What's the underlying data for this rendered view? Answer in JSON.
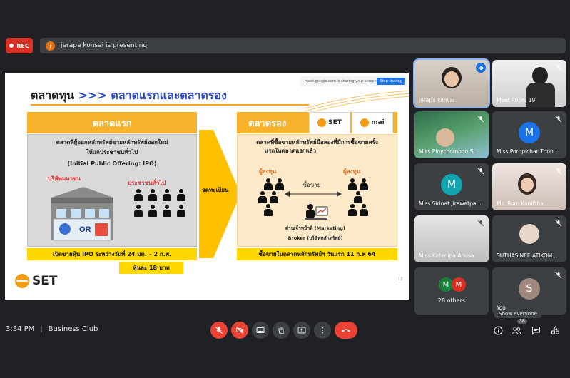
{
  "top": {
    "rec_label": "REC",
    "presenter_initial": "j",
    "presenting_text": "jerapa konsai is presenting"
  },
  "slide": {
    "share_banner": "meet.google.com is sharing your screen.",
    "stop_sharing": "Stop sharing",
    "title_prefix": "ตลาดทุน ",
    "title_arrow": ">>>",
    "title_rest": " ตลาดแรกและตลาดรอง",
    "left_header": "ตลาดแรก",
    "left_desc_1": "ตลาดที่ผู้ออกหลักทรัพย์ขายหลักทรัพย์ออกใหม่",
    "left_desc_2": "ให้แก่ประชาชนทั่วไป",
    "left_desc_3": "(Initial Public Offering: IPO)",
    "company_label": "บริษัทมหาชน",
    "public_label": "ประชาชนทั่วไป",
    "left_strip": "เปิดขายหุ้น IPO ระหว่างวันที่ 24 มค. – 2 ก.พ.",
    "price_strip": "หุ้นละ 18 บาท",
    "arrow_label": "จดทะเบียน",
    "right_header": "ตลาดรอง",
    "set_logo_text": "SET",
    "set_logo_sub": "The Stock Exchange of Thailand",
    "mai_logo_text": "mai",
    "mai_logo_sub": "Market for Alternative Investment",
    "right_desc_1": "ตลาดที่ซื้อขายหลักทรัพย์มือสองที่มีการซื้อขายครั้ง",
    "right_desc_2": "แรกในตลาดแรกแล้ว",
    "investor_left": "ผู้ลงทุน",
    "investor_right": "ผู้ลงทุน",
    "trade_label": "ซื้อขาย",
    "marketing_label": "ผ่านเจ้าหน้าที่ (Marketing)",
    "broker_label": "Broker (บริษัทหลักทรัพย์)",
    "right_strip": "ซื้อขายในตลาดหลักทรัพย์ฯ วันแรก 11 ก.พ 64",
    "footer_logo": "SET",
    "page_number": "12"
  },
  "tiles": [
    {
      "name": "jerapa konsai",
      "type": "video",
      "bg": "#cfc7bd",
      "speaking": true
    },
    {
      "name": "Meet Room 19",
      "type": "video",
      "bg": "#e8e8e8",
      "speaking": false
    },
    {
      "name": "Miss Ploychompoo S...",
      "type": "video",
      "bg": "#3b7a55",
      "speaking": false
    },
    {
      "name": "Miss Pornpichar Thon...",
      "type": "avatar",
      "initial": "M",
      "color": "#1a73e8"
    },
    {
      "name": "Miss Sirinat Jirawatpa...",
      "type": "avatar",
      "initial": "M",
      "color": "#12a4af"
    },
    {
      "name": "Ms. Rom Kanittha...",
      "type": "video",
      "bg": "#e1d6d3",
      "speaking": false
    },
    {
      "name": "Miss Katenipa Anusa...",
      "type": "video",
      "bg": "#d8d8d8",
      "speaking": false
    },
    {
      "name": "SUTHASINEE ATIKOM...",
      "type": "video",
      "bg": "#3c4043",
      "speaking": false
    },
    {
      "name": "28 others",
      "type": "others",
      "initials": [
        "M",
        "M"
      ],
      "colors": [
        "#188038",
        "#d93025"
      ]
    },
    {
      "name": "You",
      "type": "avatar",
      "initial": "S",
      "color": "#a1887f"
    }
  ],
  "tooltip": "Show everyone",
  "bottom": {
    "time": "3:34 PM",
    "meeting": "Business Club",
    "participants_count": "38"
  }
}
